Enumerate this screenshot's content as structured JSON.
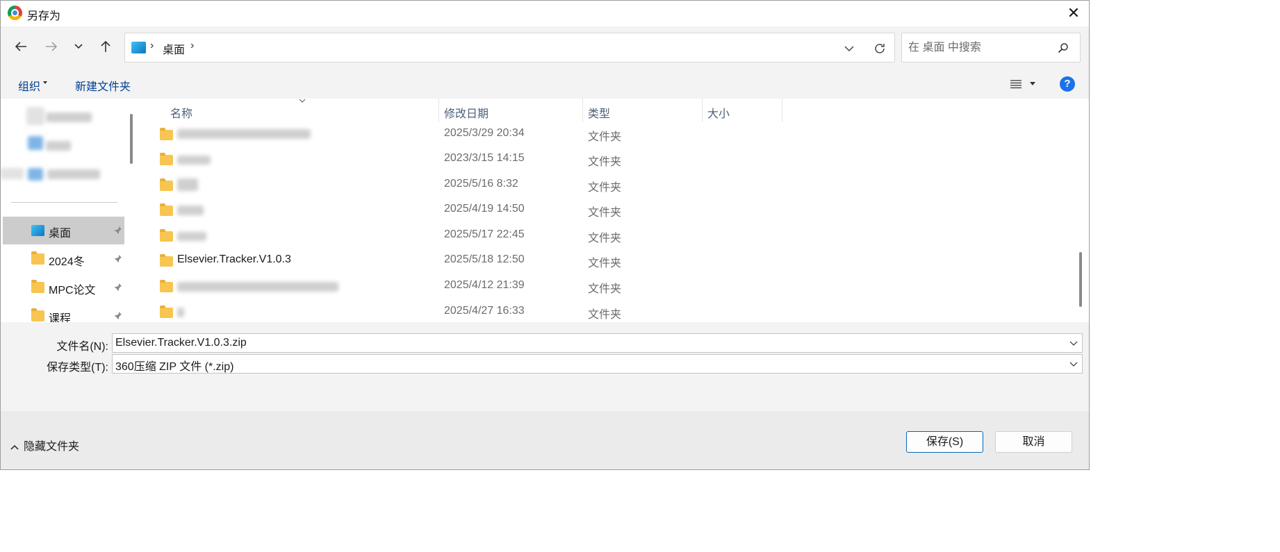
{
  "window": {
    "title": "另存为",
    "app_icon": "chrome-icon",
    "close_label": "✕"
  },
  "nav": {
    "back_icon": "back-arrow-icon",
    "forward_icon": "forward-arrow-icon",
    "recent_icon": "chevron-down-icon",
    "up_icon": "up-arrow-icon",
    "address": {
      "sep": "›",
      "location": "桌面"
    },
    "search": {
      "placeholder": "在 桌面 中搜索"
    }
  },
  "toolbar": {
    "organize_label": "组织",
    "new_folder_label": "新建文件夹",
    "help_label": "?"
  },
  "sidebar": {
    "pinned": [
      {
        "label": "桌面",
        "icon": "desktop-folder-icon",
        "selected": true
      },
      {
        "label": "2024冬",
        "icon": "folder-icon"
      },
      {
        "label": "MPC论文",
        "icon": "folder-icon"
      },
      {
        "label": "课程",
        "icon": "folder-icon"
      }
    ]
  },
  "columns": {
    "name": "名称",
    "modified": "修改日期",
    "type": "类型",
    "size": "大小"
  },
  "files": [
    {
      "name": "",
      "date": "2025/3/29 20:34",
      "type": "文件夹"
    },
    {
      "name": "",
      "date": "2023/3/15 14:15",
      "type": "文件夹"
    },
    {
      "name": "",
      "date": "2025/5/16 8:32",
      "type": "文件夹"
    },
    {
      "name": "",
      "date": "2025/4/19 14:50",
      "type": "文件夹"
    },
    {
      "name": "",
      "date": "2025/5/17 22:45",
      "type": "文件夹"
    },
    {
      "name": "Elsevier.Tracker.V1.0.3",
      "date": "2025/5/18 12:50",
      "type": "文件夹"
    },
    {
      "name": "",
      "date": "2025/4/12 21:39",
      "type": "文件夹"
    },
    {
      "name": "",
      "date": "2025/4/27 16:33",
      "type": "文件夹"
    }
  ],
  "form": {
    "filename_label": "文件名(N):",
    "filename_value": "Elsevier.Tracker.V1.0.3.zip",
    "filetype_label": "保存类型(T):",
    "filetype_value": "360压缩 ZIP 文件 (*.zip)"
  },
  "footer": {
    "hide_folders_label": "隐藏文件夹",
    "save_label": "保存(S)",
    "cancel_label": "取消"
  },
  "colors": {
    "accent": "#0067c0",
    "help_blue": "#1a73e8",
    "folder": "#f7c550",
    "selected_bg": "#cccccc"
  }
}
